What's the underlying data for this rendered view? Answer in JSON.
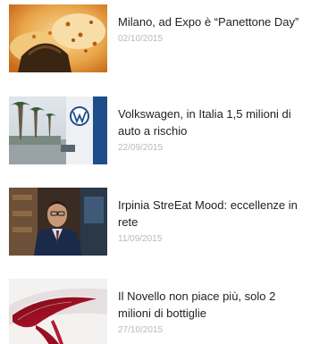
{
  "articles": [
    {
      "title": "Milano, ad Expo è “Panettone Day”",
      "date": "02/10/2015",
      "image": "panettone-photo"
    },
    {
      "title": "Volkswagen, in Italia 1,5 milioni di auto a rischio",
      "date": "22/09/2015",
      "image": "volkswagen-dealership-photo"
    },
    {
      "title": "Irpinia StreEat Mood: eccellenze in rete",
      "date": "11/09/2015",
      "image": "man-in-suit-photo"
    },
    {
      "title": "Il Novello non piace più, solo 2 milioni di bottiglie",
      "date": "27/10/2015",
      "image": "red-wine-glass-photo"
    }
  ]
}
